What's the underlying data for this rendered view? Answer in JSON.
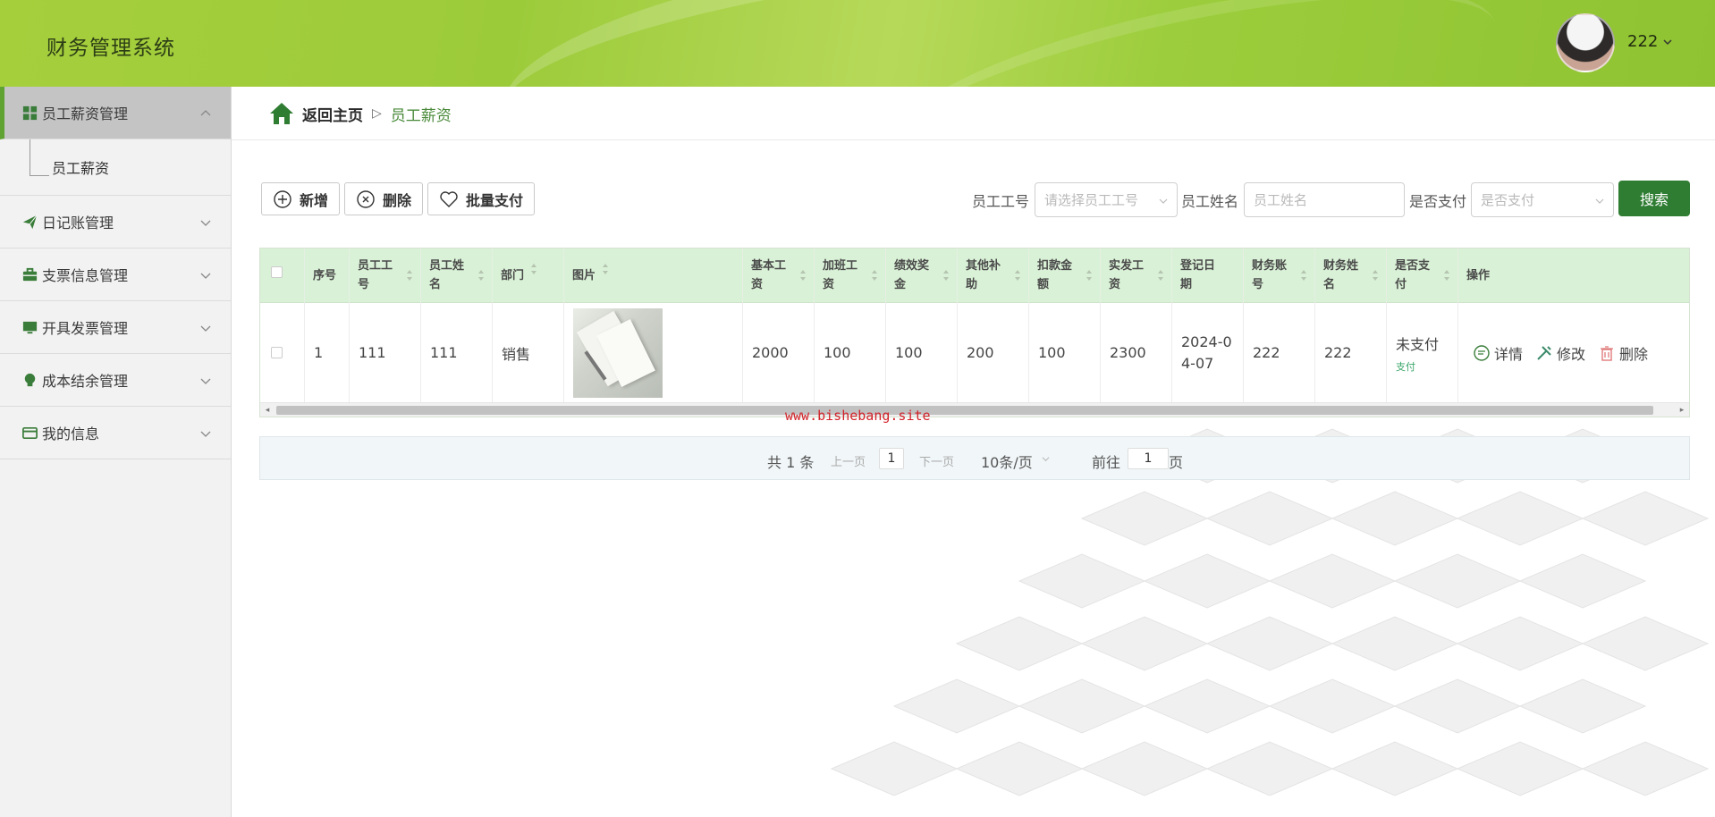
{
  "app_title": "财务管理系统",
  "user": {
    "name": "222"
  },
  "sidebar": {
    "items": [
      {
        "label": "员工薪资管理",
        "icon": "grid-icon",
        "active": true
      },
      {
        "label": "日记账管理",
        "icon": "paper-plane-icon"
      },
      {
        "label": "支票信息管理",
        "icon": "briefcase-icon"
      },
      {
        "label": "开具发票管理",
        "icon": "monitor-icon"
      },
      {
        "label": "成本结余管理",
        "icon": "lightbulb-icon"
      },
      {
        "label": "我的信息",
        "icon": "card-icon"
      }
    ],
    "submenu": [
      {
        "label": "员工薪资"
      }
    ]
  },
  "breadcrumb": {
    "home": "返回主页",
    "separator": "▷",
    "current": "员工薪资"
  },
  "toolbar": {
    "add": "新增",
    "delete": "删除",
    "batch_pay": "批量支付"
  },
  "filters": {
    "emp_no_label": "员工工号",
    "emp_no_placeholder": "请选择员工工号",
    "emp_name_label": "员工姓名",
    "emp_name_placeholder": "员工姓名",
    "paid_label": "是否支付",
    "paid_placeholder": "是否支付",
    "search": "搜索"
  },
  "table": {
    "headers": [
      "序号",
      "员工工\n号",
      "员工姓\n名",
      "部门",
      "图片",
      "基本工\n资",
      "加班工\n资",
      "绩效奖\n金",
      "其他补\n助",
      "扣款金\n额",
      "实发工\n资",
      "登记日\n期",
      "财务账\n号",
      "财务姓\n名",
      "是否支\n付",
      "操作"
    ],
    "rows": [
      {
        "index": "1",
        "emp_no": "111",
        "emp_name": "111",
        "dept": "销售",
        "base_salary": "2000",
        "overtime": "100",
        "bonus": "100",
        "allowance": "200",
        "deduction": "100",
        "net_pay": "2300",
        "date": "2024-04-07",
        "fin_account": "222",
        "fin_name": "222",
        "paid_status": "未支付",
        "pay_link": "支付",
        "ops": {
          "detail": "详情",
          "edit": "修改",
          "delete": "删除"
        }
      }
    ]
  },
  "watermark": "www.bishebang.site",
  "pagination": {
    "total": "共 1 条",
    "prev": "上一页",
    "page": "1",
    "next": "下一页",
    "page_size": "10条/页",
    "goto_label": "前往",
    "goto_value": "1",
    "goto_suffix": "页"
  },
  "colors": {
    "accent": "#2f7d32",
    "header_bg": "#a6cf3c",
    "table_head": "#d9f1d6",
    "active_bar": "#60a332"
  }
}
